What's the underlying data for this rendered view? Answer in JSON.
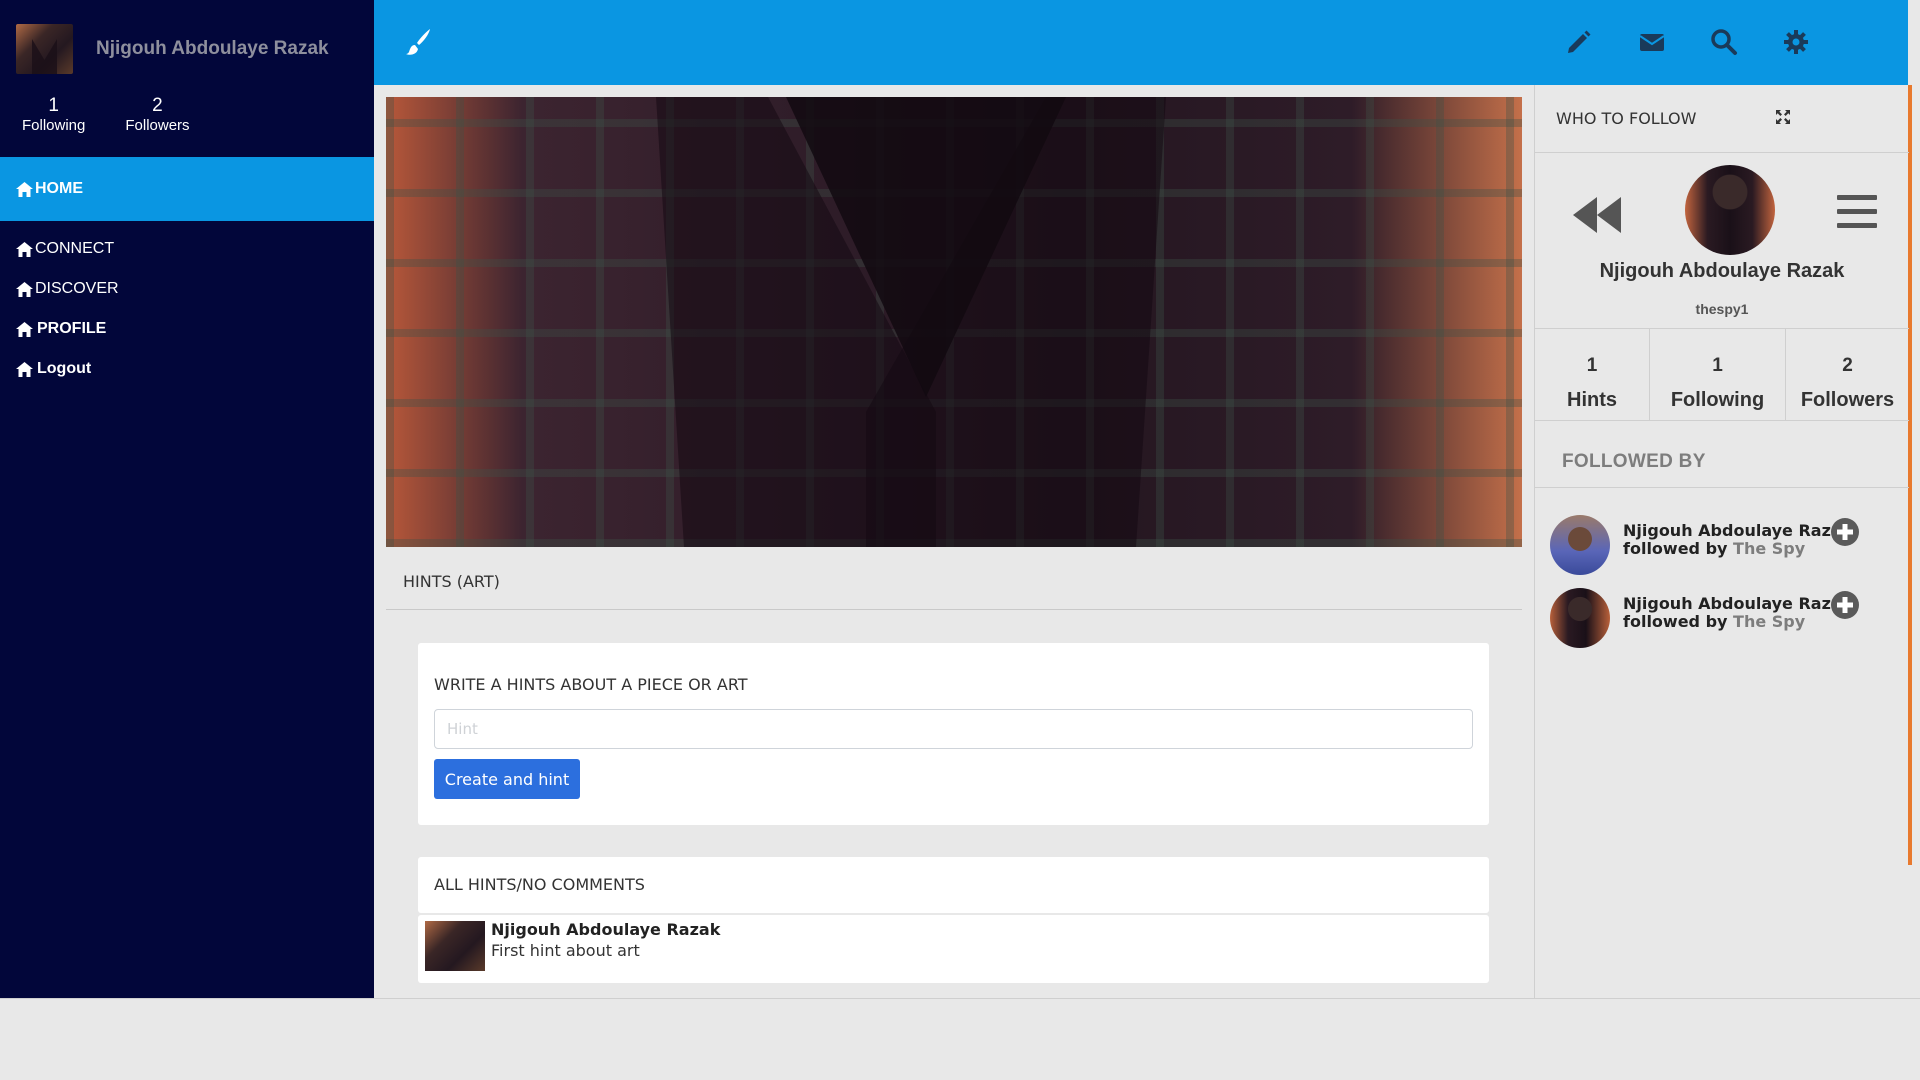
{
  "sidebar": {
    "user_name": "Njigouh Abdoulaye Razak",
    "stats": [
      {
        "value": "1",
        "label": "Following"
      },
      {
        "value": "2",
        "label": "Followers"
      }
    ],
    "nav": [
      {
        "label": "HOME",
        "icon": "home-icon"
      },
      {
        "label": "CONNECT",
        "icon": "home-icon"
      },
      {
        "label": "DISCOVER",
        "icon": "home-icon"
      },
      {
        "label": "PROFILE",
        "icon": "home-icon"
      },
      {
        "label": "Logout",
        "icon": "home-icon"
      }
    ]
  },
  "topbar": {
    "brand_icon": "paintbrush-icon",
    "icons": [
      "pencil-icon",
      "envelope-icon",
      "search-icon",
      "gear-icon"
    ]
  },
  "main": {
    "section_title": "HINTS (ART)",
    "write_label": "WRITE A HINTS ABOUT A PIECE OR ART",
    "hint_input": {
      "value": "",
      "placeholder": "Hint"
    },
    "create_button": "Create and hint",
    "all_hints_label": "ALL HINTS/NO COMMENTS",
    "hints": [
      {
        "author": "Njigouh Abdoulaye Razak",
        "text": "First hint about art"
      }
    ]
  },
  "right_panel": {
    "title": "WHO TO FOLLOW",
    "profile_name": "Njigouh Abdoulaye Razak",
    "handle": "thespy1",
    "stats": [
      {
        "value": "1",
        "label": "Hints"
      },
      {
        "value": "1",
        "label": "Following"
      },
      {
        "value": "2",
        "label": "Followers"
      }
    ],
    "followed_by_title": "FOLLOWED BY",
    "followed_by": [
      {
        "name": "Njigouh Abdoulaye Razak",
        "followed_by_text": "followed by",
        "follower": "The Spy"
      },
      {
        "name": "Njigouh Abdoulaye Razak",
        "followed_by_text": "followed by",
        "follower": "The Spy"
      }
    ]
  },
  "colors": {
    "sidebar_bg": "#02063a",
    "accent": "#0a96e2",
    "button": "#2c6fde",
    "strip": "#e8792e"
  }
}
